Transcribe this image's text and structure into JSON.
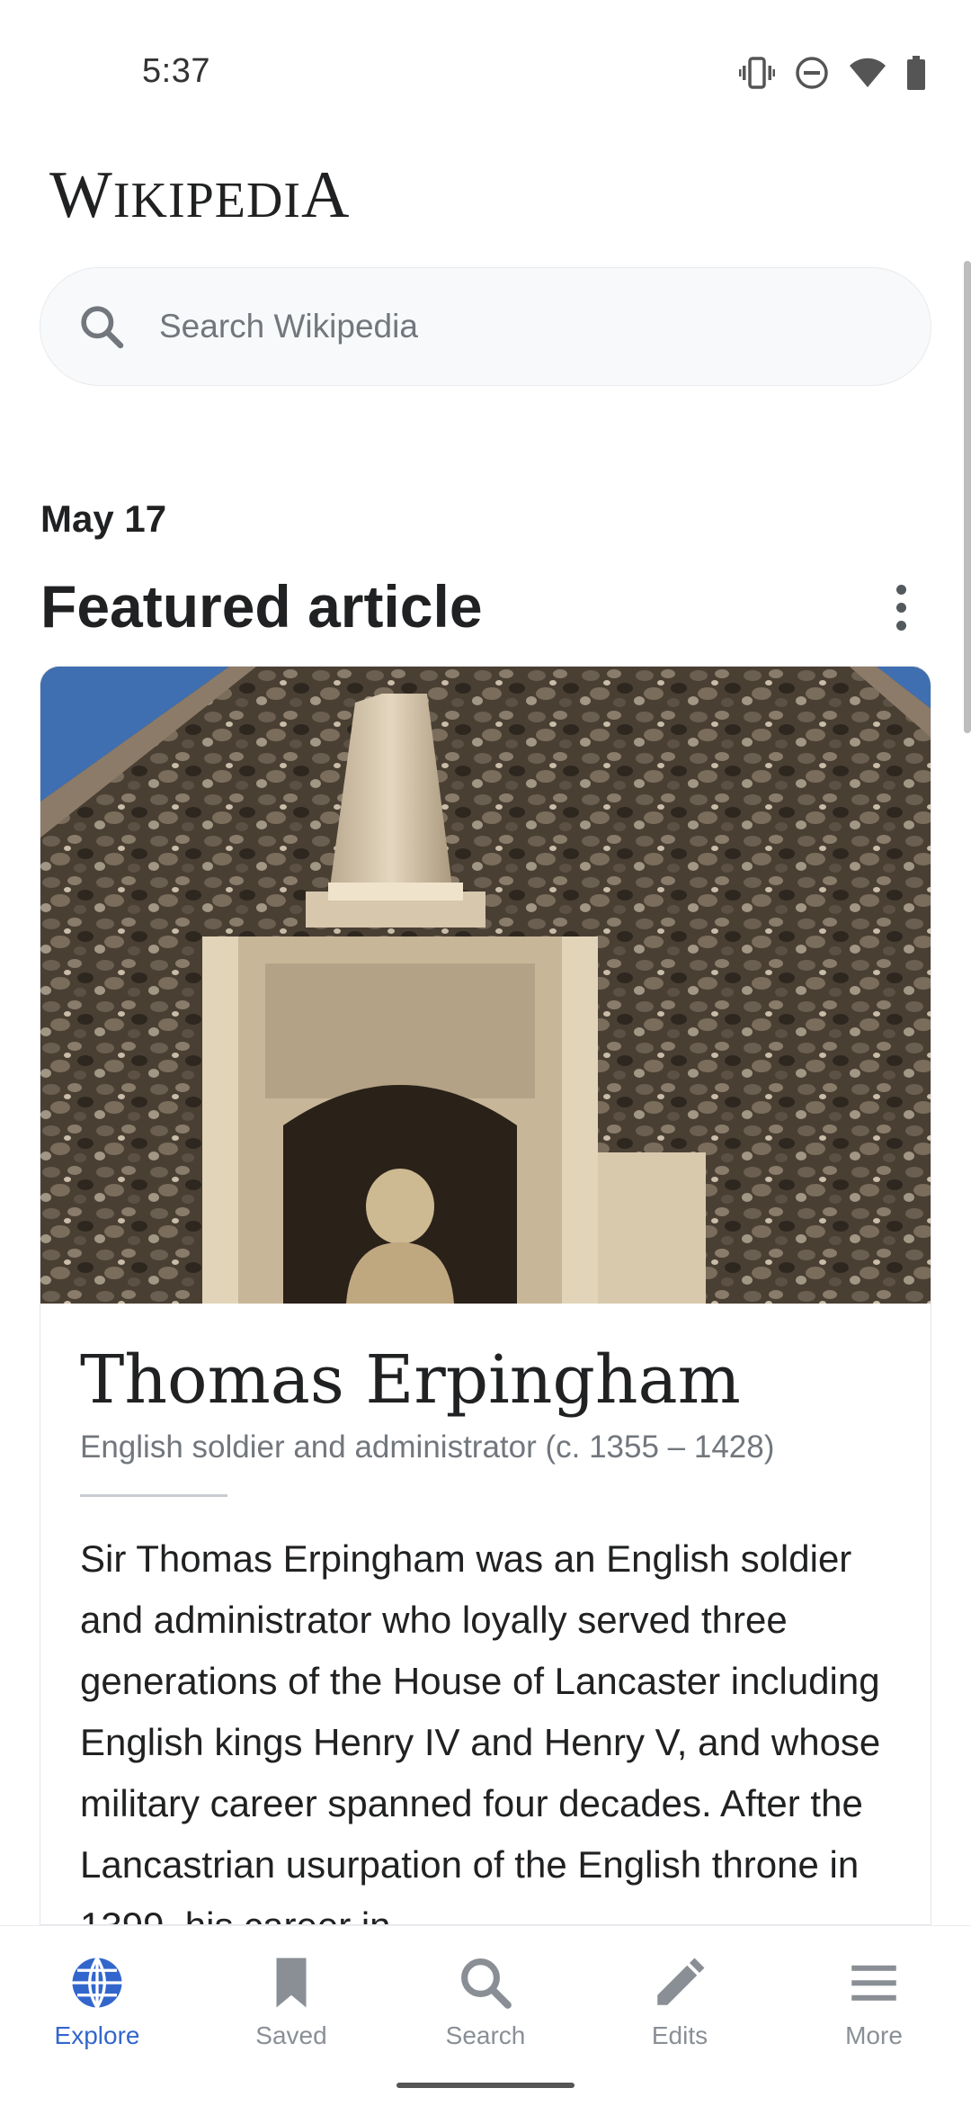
{
  "status_bar": {
    "time": "5:37",
    "icons": [
      "vibrate-icon",
      "do-not-disturb-icon",
      "wifi-icon",
      "battery-icon"
    ]
  },
  "header": {
    "logo_text_w": "W",
    "logo_text_rest": "IKIPEDI",
    "logo_text_a": "A"
  },
  "search": {
    "placeholder": "Search Wikipedia",
    "icon": "search-icon"
  },
  "feed": {
    "date": "May 17",
    "section_title": "Featured article",
    "menu_icon": "overflow-menu-icon"
  },
  "article": {
    "title": "Thomas Erpingham",
    "description": "English soldier and administrator (c. 1355 – 1428)",
    "extract": "Sir Thomas Erpingham was an English soldier and administrator who loyally served three generations of the House of Lancaster including English kings Henry IV and Henry V, and whose military career spanned four decades. After the Lancastrian usurpation of the English throne in 1399, his career in"
  },
  "bottom_nav": {
    "items": [
      {
        "label": "Explore",
        "icon": "globe-icon",
        "active": true
      },
      {
        "label": "Saved",
        "icon": "bookmark-icon",
        "active": false
      },
      {
        "label": "Search",
        "icon": "search-icon",
        "active": false
      },
      {
        "label": "Edits",
        "icon": "pencil-icon",
        "active": false
      },
      {
        "label": "More",
        "icon": "menu-icon",
        "active": false
      }
    ]
  },
  "colors": {
    "accent": "#3366cc",
    "text": "#202122",
    "muted": "#72777d"
  }
}
